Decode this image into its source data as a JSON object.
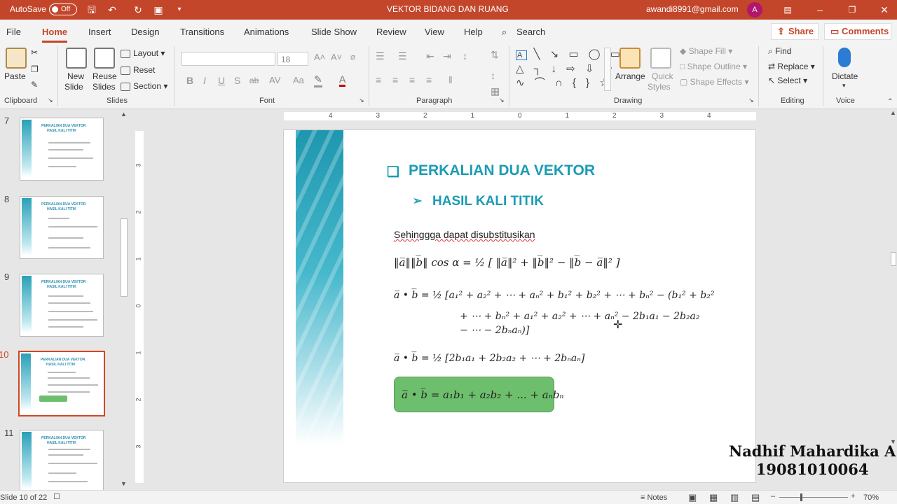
{
  "titlebar": {
    "autosave_label": "AutoSave",
    "autosave_state": "Off",
    "doc_title": "VEKTOR BIDANG DAN RUANG",
    "account_email": "awandi8991@gmail.com",
    "avatar_letter": "A",
    "accent": "#c3462b"
  },
  "tabs": [
    "File",
    "Home",
    "Insert",
    "Design",
    "Transitions",
    "Animations",
    "Slide Show",
    "Review",
    "View",
    "Help"
  ],
  "search_label": "Search",
  "share_label": "Share",
  "comments_label": "Comments",
  "ribbon": {
    "clipboard": {
      "paste": "Paste",
      "group": "Clipboard"
    },
    "slides": {
      "new_slide_1": "New",
      "new_slide_2": "Slide",
      "reuse_1": "Reuse",
      "reuse_2": "Slides",
      "layout": "Layout",
      "reset": "Reset",
      "section": "Section",
      "group": "Slides"
    },
    "font": {
      "size": "18",
      "group": "Font",
      "bold": "B",
      "italic": "I",
      "underline": "U",
      "strike": "S",
      "shadow": "ab"
    },
    "paragraph": {
      "group": "Paragraph"
    },
    "drawing": {
      "arrange": "Arrange",
      "quick_1": "Quick",
      "quick_2": "Styles",
      "shape_fill": "Shape Fill",
      "shape_outline": "Shape Outline",
      "shape_effects": "Shape Effects",
      "group": "Drawing"
    },
    "editing": {
      "find": "Find",
      "replace": "Replace",
      "select": "Select",
      "group": "Editing"
    },
    "voice": {
      "dictate": "Dictate",
      "group": "Voice"
    }
  },
  "ruler_h": [
    "4",
    "3",
    "2",
    "1",
    "0",
    "1",
    "2",
    "3",
    "4"
  ],
  "ruler_v": [
    "3",
    "2",
    "1",
    "0",
    "1",
    "2",
    "3"
  ],
  "thumbnails": [
    {
      "num": "7",
      "title": "PERKALIAN DUA VEKTOR",
      "sub": "HASIL KALI TITIK"
    },
    {
      "num": "8",
      "title": "PERKALIAN DUA VEKTOR",
      "sub": "HASIL KALI TITIK"
    },
    {
      "num": "9",
      "title": "PERKALIAN DUA VEKTOR",
      "sub": "HASIL KALI TITIK"
    },
    {
      "num": "10",
      "title": "PERKALIAN DUA VEKTOR",
      "sub": "HASIL KALI TITIK"
    },
    {
      "num": "11",
      "title": "PERKALIAN DUA VEKTOR",
      "sub": "HASIL KALI TITIK"
    }
  ],
  "slide": {
    "title": "PERKALIAN DUA VEKTOR",
    "subtitle": "HASIL KALI TITIK",
    "intro": "Sehinggga dapat disubstitusikan",
    "eq1": "‖a̅‖‖b̅‖ cos α = ½ [ ‖a̅‖² + ‖b̅‖² − ‖b̅ − a̅‖² ]",
    "eq2_l1": "a̅ • b̅ = ½ [a₁² + a₂² + ⋯ + aₙ² + b₁² + b₂² + ⋯ + bₙ² − (b₁² + b₂²",
    "eq2_l2": "+ ⋯ + bₙ² + a₁² + a₂² + ⋯ + aₙ² − 2b₁a₁ − 2b₂a₂",
    "eq2_l3": "− ⋯ − 2bₙaₙ)]",
    "eq3": "a̅ • b̅ = ½ [2b₁a₁ + 2b₂a₂ + ⋯ + 2bₙaₙ]",
    "result": "a̅ • b̅ = a₁b₁ + a₂b₂ + ... + aₙbₙ"
  },
  "watermark": {
    "name": "Nadhif Mahardika A",
    "nim": "19081010064"
  },
  "status": {
    "slide_of": "Slide 10 of 22",
    "notes": "Notes",
    "zoom": "70%"
  }
}
